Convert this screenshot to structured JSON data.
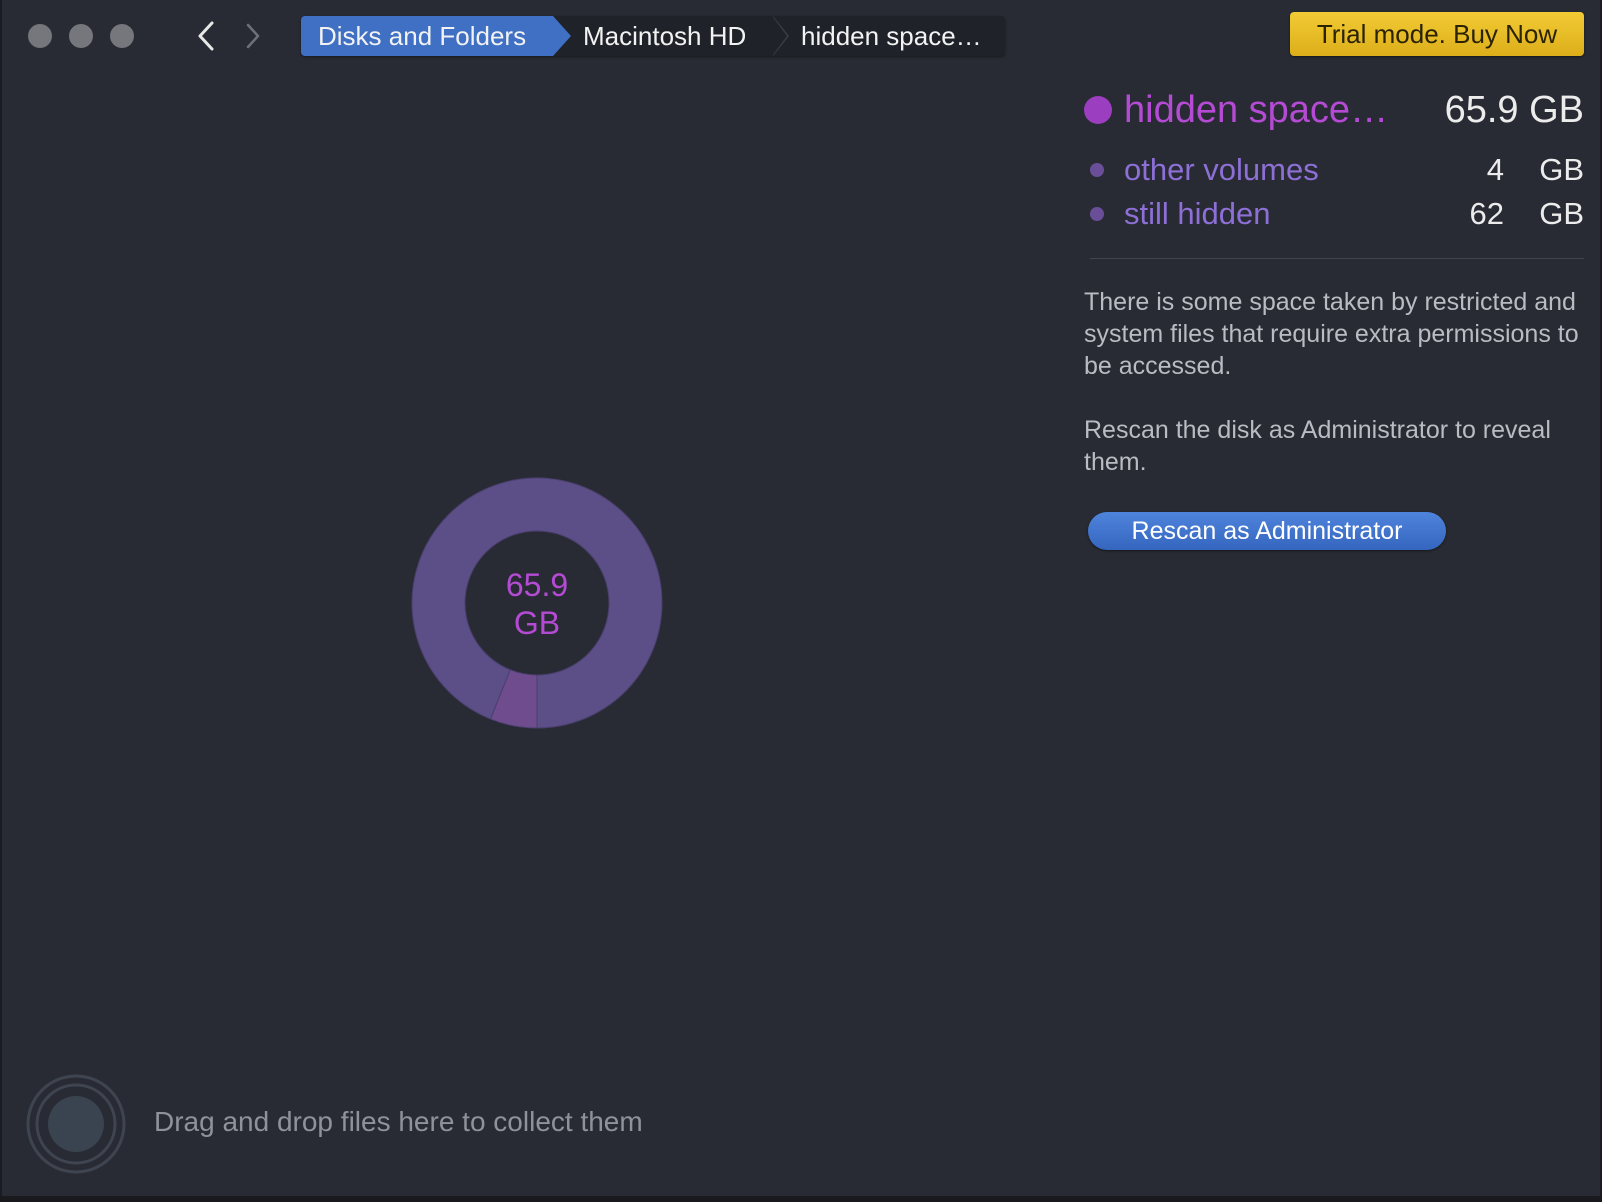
{
  "window": {
    "traffic_lights": [
      "close",
      "minimize",
      "zoom"
    ]
  },
  "nav": {
    "back_icon": "chevron-left-icon",
    "forward_icon": "chevron-right-icon"
  },
  "breadcrumb": {
    "items": [
      {
        "label": "Disks and Folders",
        "active": true
      },
      {
        "label": "Macintosh HD",
        "active": false
      },
      {
        "label": "hidden space…",
        "active": false
      }
    ]
  },
  "toolbar": {
    "trial_label": "Trial mode. Buy Now"
  },
  "summary": {
    "name": "hidden space…",
    "size": "65.9 GB",
    "items": [
      {
        "name": "other volumes",
        "value": "4",
        "unit": "GB"
      },
      {
        "name": "still hidden",
        "value": "62",
        "unit": "GB"
      }
    ]
  },
  "description": {
    "paragraph1": "There is some space taken by restricted and system files that require extra permissions to be accessed.",
    "paragraph2": "Rescan the disk as Administrator to reveal them."
  },
  "rescan_button": {
    "label": "Rescan as Administrator"
  },
  "chart": {
    "center_value": "65.9",
    "center_unit": "GB"
  },
  "chart_data": {
    "type": "pie",
    "categories": [
      "still hidden",
      "other volumes"
    ],
    "values": [
      62,
      4
    ],
    "title": "",
    "colors": [
      "#5c4e86",
      "#6e4c8e"
    ]
  },
  "drop_zone": {
    "label": "Drag and drop files here to collect them",
    "icon": "collector-icon"
  },
  "colors": {
    "background": "#282b33",
    "accent_blue": "#3f70c4",
    "trial_yellow": "#e8bd26",
    "hidden_magenta": "#b54bd4",
    "sub_purple": "#8d6fd6"
  }
}
